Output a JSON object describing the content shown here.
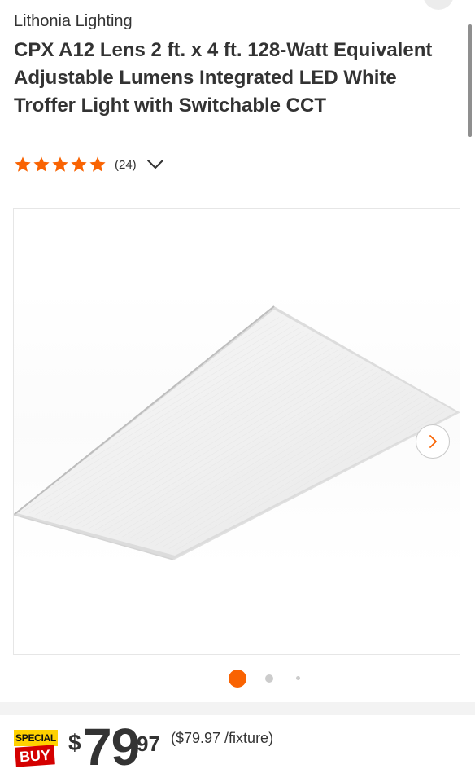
{
  "product": {
    "brand": "Lithonia Lighting",
    "title": "CPX A12 Lens 2 ft. x 4 ft. 128-Watt Equivalent Adjustable Lumens Integrated LED White Troffer Light with Switchable CCT"
  },
  "rating": {
    "stars": 5,
    "max_stars": 5,
    "review_count": "(24)",
    "star_color": "#f96302",
    "expand_icon": "chevron-down-icon"
  },
  "gallery": {
    "image_subject": "troffer-light-panel",
    "next_icon": "chevron-right-icon",
    "image_count": 3,
    "active_index": 0,
    "active_dot_color": "#f96302",
    "inactive_dot_color": "#cccccc"
  },
  "pricing": {
    "badge_top": "SPECIAL",
    "badge_bottom": "BUY",
    "currency_symbol": "$",
    "dollars": "79",
    "cents": "97",
    "unit_price": "($79.97 /fixture)"
  }
}
